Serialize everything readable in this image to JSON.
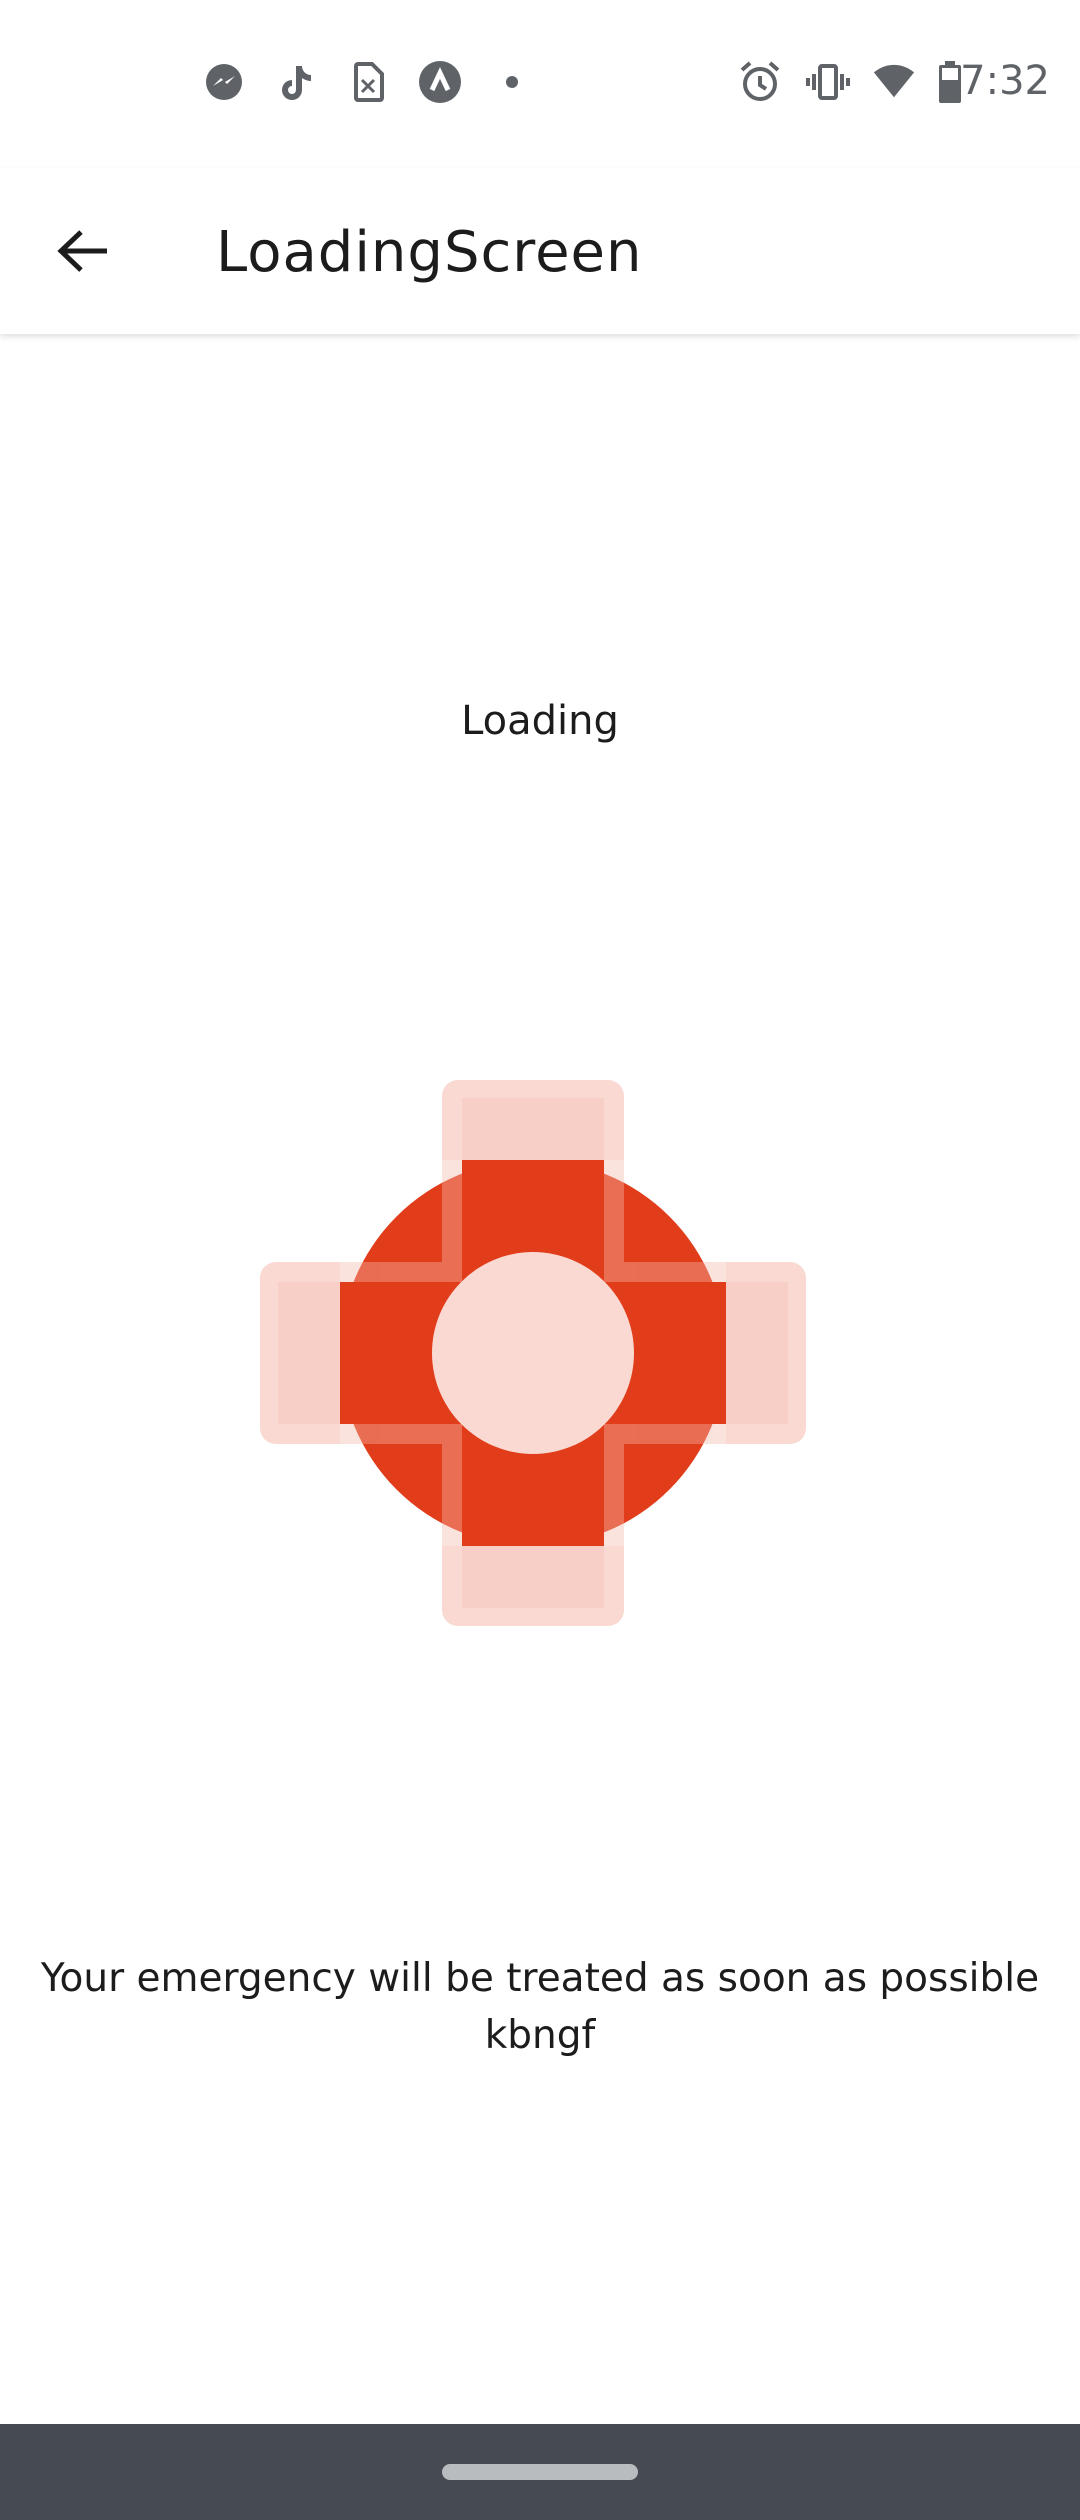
{
  "status_bar": {
    "time": "7:32",
    "left_icons": [
      "messenger-icon",
      "tiktok-icon",
      "sim-card-icon",
      "app-caret-icon",
      "dot-icon"
    ],
    "right_icons": [
      "alarm-icon",
      "vibrate-icon",
      "wifi-icon",
      "battery-icon"
    ]
  },
  "app_bar": {
    "title": "LoadingScreen",
    "back_icon": "arrow-back-icon"
  },
  "content": {
    "loading_label": "Loading",
    "message": "Your emergency will be treated as soon as possible kbngf"
  },
  "colors": {
    "accent": "#e23d1a",
    "light_accent": "#f9d9d2",
    "nav_bar": "#454b51"
  }
}
